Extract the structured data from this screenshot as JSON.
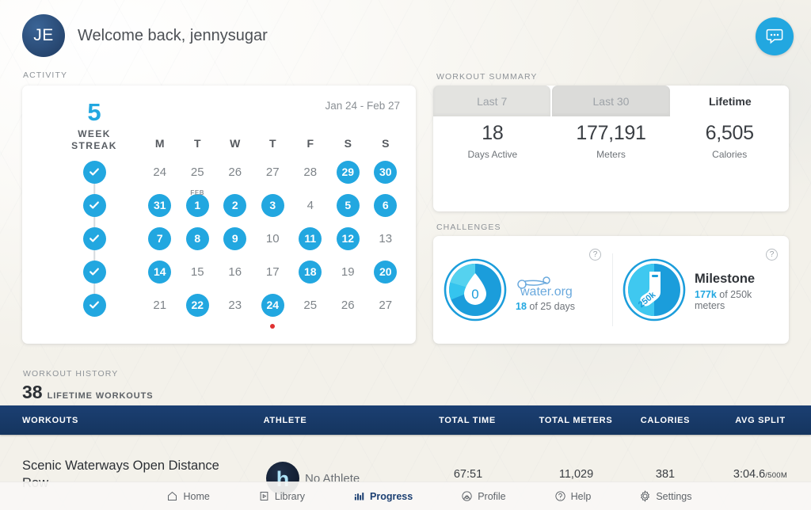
{
  "header": {
    "avatar_initials": "JE",
    "welcome": "Welcome back, jennysugar",
    "chat_icon": "chat-bubble-icon"
  },
  "activity": {
    "label": "ACTIVITY",
    "streak_count": "5",
    "streak_line1": "WEEK",
    "streak_line2": "STREAK",
    "checks": [
      "check-icon",
      "check-icon",
      "check-icon",
      "check-icon",
      "check-icon"
    ],
    "date_range": "Jan 24 - Feb 27",
    "dow": [
      "M",
      "T",
      "W",
      "T",
      "F",
      "S",
      "S"
    ],
    "weeks": [
      [
        {
          "d": "24",
          "on": false
        },
        {
          "d": "25",
          "on": false
        },
        {
          "d": "26",
          "on": false
        },
        {
          "d": "27",
          "on": false
        },
        {
          "d": "28",
          "on": false
        },
        {
          "d": "29",
          "on": true
        },
        {
          "d": "30",
          "on": true
        }
      ],
      [
        {
          "d": "31",
          "on": true
        },
        {
          "d": "1",
          "on": true,
          "month": "FEB"
        },
        {
          "d": "2",
          "on": true
        },
        {
          "d": "3",
          "on": true
        },
        {
          "d": "4",
          "on": false
        },
        {
          "d": "5",
          "on": true
        },
        {
          "d": "6",
          "on": true
        }
      ],
      [
        {
          "d": "7",
          "on": true
        },
        {
          "d": "8",
          "on": true
        },
        {
          "d": "9",
          "on": true
        },
        {
          "d": "10",
          "on": false
        },
        {
          "d": "11",
          "on": true
        },
        {
          "d": "12",
          "on": true
        },
        {
          "d": "13",
          "on": false
        }
      ],
      [
        {
          "d": "14",
          "on": true
        },
        {
          "d": "15",
          "on": false
        },
        {
          "d": "16",
          "on": false
        },
        {
          "d": "17",
          "on": false
        },
        {
          "d": "18",
          "on": true
        },
        {
          "d": "19",
          "on": false
        },
        {
          "d": "20",
          "on": true
        }
      ],
      [
        {
          "d": "21",
          "on": false
        },
        {
          "d": "22",
          "on": true
        },
        {
          "d": "23",
          "on": false
        },
        {
          "d": "24",
          "on": true,
          "today": true
        },
        {
          "d": "25",
          "on": false
        },
        {
          "d": "26",
          "on": false
        },
        {
          "d": "27",
          "on": false
        }
      ]
    ]
  },
  "summary": {
    "label": "WORKOUT SUMMARY",
    "tabs": [
      {
        "label": "Last 7",
        "active": false
      },
      {
        "label": "Last 30",
        "active": false
      },
      {
        "label": "Lifetime",
        "active": true
      }
    ],
    "stats": [
      {
        "value": "18",
        "label": "Days Active"
      },
      {
        "value": "177,191",
        "label": "Meters"
      },
      {
        "value": "6,505",
        "label": "Calories"
      }
    ]
  },
  "challenges": {
    "label": "CHALLENGES",
    "items": [
      {
        "badge_icon": "water-drop-badge-icon",
        "badge_value": "0",
        "title": "water.org",
        "progress_value": "18",
        "progress_rest": " of 25 days",
        "help_icon": "question-mark-icon"
      },
      {
        "badge_icon": "sock-milestone-badge-icon",
        "badge_value": "250k",
        "title": "Milestone",
        "progress_value": "177k",
        "progress_rest": " of 250k meters",
        "help_icon": "question-mark-icon"
      }
    ]
  },
  "workout_history": {
    "label": "WORKOUT HISTORY",
    "count": "38",
    "count_label": "LIFETIME WORKOUTS",
    "columns": [
      "WORKOUTS",
      "ATHLETE",
      "TOTAL TIME",
      "TOTAL METERS",
      "CALORIES",
      "AVG SPLIT"
    ],
    "rows": [
      {
        "name": "Scenic Waterways Open Distance Row",
        "athlete": "No Athlete",
        "athlete_logo": "h",
        "total_time": "67:51",
        "total_meters": "11,029",
        "calories": "381",
        "avg_split": "3:04.6",
        "avg_split_unit": "/500M"
      }
    ]
  },
  "bottom_nav": [
    {
      "label": "Home",
      "icon": "home-icon",
      "active": false
    },
    {
      "label": "Library",
      "icon": "library-icon",
      "active": false
    },
    {
      "label": "Progress",
      "icon": "progress-bars-icon",
      "active": true
    },
    {
      "label": "Profile",
      "icon": "profile-icon",
      "active": false
    },
    {
      "label": "Help",
      "icon": "help-icon",
      "active": false
    },
    {
      "label": "Settings",
      "icon": "gear-icon",
      "active": false
    }
  ],
  "colors": {
    "accent_blue": "#22a7e0",
    "navy": "#1b3f72",
    "avatar_navy": "#2e5481",
    "today_dot_red": "#e03131"
  }
}
